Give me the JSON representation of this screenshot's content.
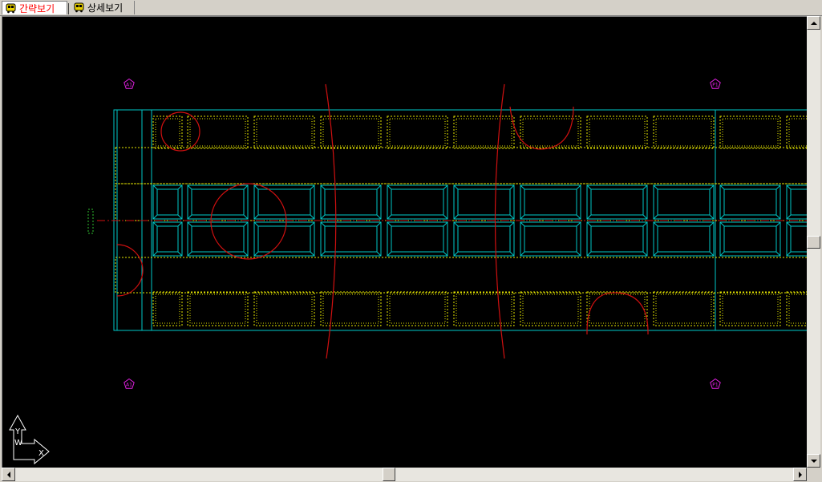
{
  "tabs": [
    {
      "label": "간략보기",
      "active": true,
      "color": "#ff0000"
    },
    {
      "label": "상세보기",
      "active": false,
      "color": "#000000"
    }
  ],
  "drawing": {
    "background": "#000000",
    "colors": {
      "outline": "#00c8c8",
      "hatch": "#e6e600",
      "cloud": "#d01010",
      "marker": "#e020e0",
      "axis_icon": "#ffffff",
      "centerline": "#d01010"
    },
    "grid_markers": [
      {
        "label": "A1"
      },
      {
        "label": "P1"
      },
      {
        "label": "A1"
      },
      {
        "label": "P1"
      }
    ],
    "ucs_icon": {
      "x_label": "X",
      "y_label": "Y",
      "w_label": "W"
    }
  },
  "scrollbars": {
    "vertical_position": 0.5,
    "horizontal_position": 0.48
  }
}
